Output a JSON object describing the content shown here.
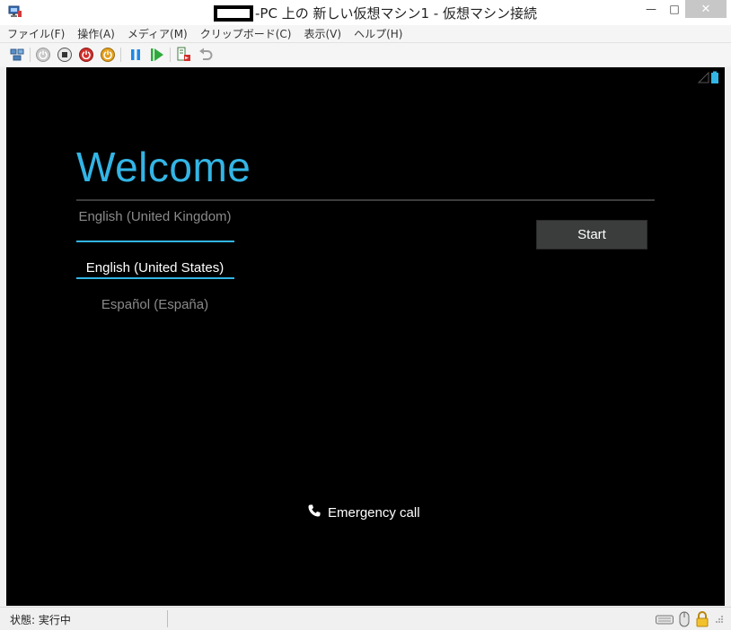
{
  "window": {
    "title": "-PC 上の 新しい仮想マシン1  - 仮想マシン接続",
    "minimize_glyph": "—",
    "maximize_glyph": "□",
    "close_glyph": "✕"
  },
  "menu": {
    "items": [
      {
        "label": "ファイル(F)"
      },
      {
        "label": "操作(A)"
      },
      {
        "label": "メディア(M)"
      },
      {
        "label": "クリップボード(C)"
      },
      {
        "label": "表示(V)"
      },
      {
        "label": "ヘルプ(H)"
      }
    ]
  },
  "toolbar": {
    "icons": [
      "ctrl-alt-del-icon",
      "start-icon",
      "turn-off-icon",
      "shutdown-icon",
      "save-icon",
      "pause-icon",
      "resume-icon",
      "checkpoint-icon",
      "revert-icon"
    ]
  },
  "vm": {
    "welcome_title": "Welcome",
    "languages": {
      "previous": "English (United Kingdom)",
      "selected": "English (United States)",
      "next": "Español (España)"
    },
    "start_label": "Start",
    "emergency_label": "Emergency call",
    "accent_color": "#33b5e5"
  },
  "status": {
    "text": "状態: 実行中"
  }
}
